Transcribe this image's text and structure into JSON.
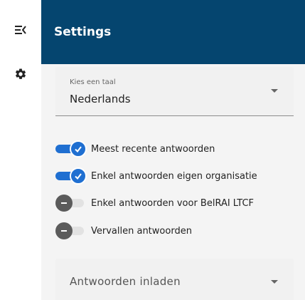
{
  "rail": {
    "items": [
      {
        "icon": "collapse-menu-icon"
      },
      {
        "icon": "gear-icon"
      }
    ]
  },
  "panel": {
    "title": "Settings",
    "language_select": {
      "label": "Kies een taal",
      "value": "Nederlands"
    },
    "toggles": [
      {
        "label": "Meest recente antwoorden",
        "on": true
      },
      {
        "label": "Enkel antwoorden eigen organisatie",
        "on": true
      },
      {
        "label": "Enkel antwoorden voor BelRAI LTCF",
        "on": false
      },
      {
        "label": "Vervallen antwoorden",
        "on": false
      }
    ],
    "load_select": {
      "value": "Antwoorden inladen"
    }
  },
  "colors": {
    "header": "#05456f",
    "accent": "#1f6fd1",
    "toggle_off_knob": "#5b5b5b",
    "toggle_off_track": "#e2e2e2"
  }
}
